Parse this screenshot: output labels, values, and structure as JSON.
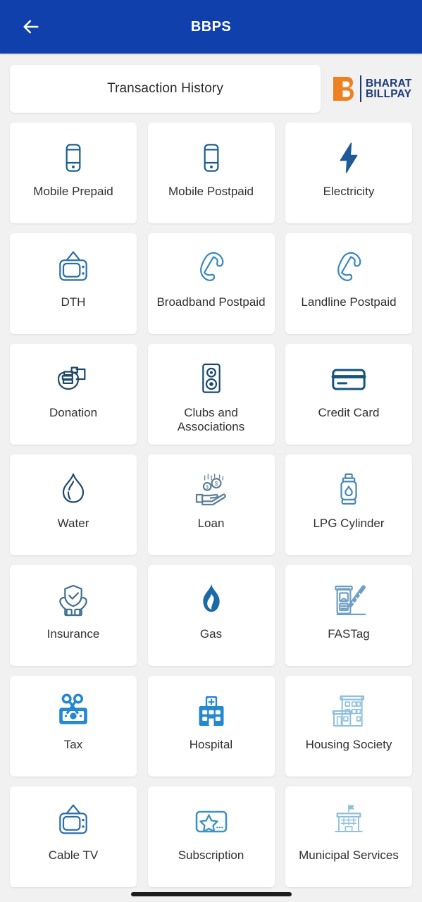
{
  "header": {
    "title": "BBPS",
    "back_icon": "arrow-left-icon",
    "bg_color": "#0f40ac",
    "title_color": "#ffffff"
  },
  "history": {
    "label": "Transaction History",
    "logo": {
      "mark_letter": "B",
      "mark_color": "#ef8022",
      "line1": "BHARAT",
      "line2": "BILLPAY",
      "text_color": "#1b3a75"
    }
  },
  "grid": {
    "columns": 3,
    "tiles": [
      {
        "label": "Mobile Prepaid",
        "icon": "mobile-phone-icon",
        "color": "#1b5f8f"
      },
      {
        "label": "Mobile Postpaid",
        "icon": "mobile-phone-icon",
        "color": "#1b5f8f"
      },
      {
        "label": "Electricity",
        "icon": "lightning-bolt-icon",
        "color": "#1d5a96"
      },
      {
        "label": "DTH",
        "icon": "television-icon",
        "color": "#2a6ea8"
      },
      {
        "label": "Broadband Postpaid",
        "icon": "telephone-handset-icon",
        "color": "#3a88bd"
      },
      {
        "label": "Landline Postpaid",
        "icon": "telephone-handset-icon",
        "color": "#3a88bd"
      },
      {
        "label": "Donation",
        "icon": "donating-hand-icon",
        "color": "#1f4a66"
      },
      {
        "label": "Clubs and Associations",
        "icon": "speaker-icon",
        "color": "#164a72"
      },
      {
        "label": "Credit Card",
        "icon": "credit-card-icon",
        "color": "#15547f"
      },
      {
        "label": "Water",
        "icon": "water-drop-icon",
        "color": "#1f4a6b"
      },
      {
        "label": "Loan",
        "icon": "hand-with-coins-icon",
        "color": "#5c7f96"
      },
      {
        "label": "LPG Cylinder",
        "icon": "gas-cylinder-icon",
        "color": "#4a89b5"
      },
      {
        "label": "Insurance",
        "icon": "shield-in-hands-icon",
        "color": "#44708e"
      },
      {
        "label": "Gas",
        "icon": "gas-flame-icon",
        "color": "#1a6aa8"
      },
      {
        "label": "FASTag",
        "icon": "toll-booth-icon",
        "color": "#6f9fc4"
      },
      {
        "label": "Tax",
        "icon": "money-scissors-icon",
        "color": "#2389d1"
      },
      {
        "label": "Hospital",
        "icon": "hospital-icon",
        "color": "#2389d1"
      },
      {
        "label": "Housing Society",
        "icon": "apartment-buildings-icon",
        "color": "#8fc0dd"
      },
      {
        "label": "Cable TV",
        "icon": "television-icon",
        "color": "#2a6ea8"
      },
      {
        "label": "Subscription",
        "icon": "star-card-icon",
        "color": "#3f92c4"
      },
      {
        "label": "Municipal Services",
        "icon": "government-building-icon",
        "color": "#8fc0dd"
      }
    ]
  },
  "system": {
    "gesture_bar": "home-indicator"
  }
}
